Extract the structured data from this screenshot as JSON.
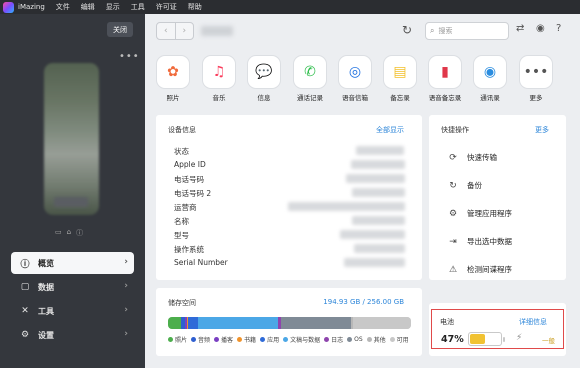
{
  "menubar": {
    "app_name": "iMazing",
    "items": [
      "文件",
      "编辑",
      "显示",
      "工具",
      "许可证",
      "帮助"
    ]
  },
  "sidebar": {
    "close_label": "关闭",
    "more": "•••",
    "nav": [
      {
        "label": "概览",
        "icon": "info-icon"
      },
      {
        "label": "数据",
        "icon": "square-icon"
      },
      {
        "label": "工具",
        "icon": "tools-icon"
      },
      {
        "label": "设置",
        "icon": "gear-icon"
      }
    ]
  },
  "toolbar": {
    "search_placeholder": "搜索"
  },
  "apps": [
    {
      "label": "照片",
      "icon": "photos-icon",
      "glyph": "✿",
      "color": "#f06a3b"
    },
    {
      "label": "音乐",
      "icon": "music-icon",
      "glyph": "♫",
      "color": "#fa3c5c"
    },
    {
      "label": "信息",
      "icon": "messages-icon",
      "glyph": "💬",
      "color": "#2cbd4a"
    },
    {
      "label": "通话记录",
      "icon": "phone-icon",
      "glyph": "✆",
      "color": "#2cbd4a"
    },
    {
      "label": "语音信箱",
      "icon": "voicemail-icon",
      "glyph": "◎",
      "color": "#1d6fe0"
    },
    {
      "label": "备忘录",
      "icon": "notes-icon",
      "glyph": "▤",
      "color": "#f2c12e"
    },
    {
      "label": "语音备忘录",
      "icon": "voice-memos-icon",
      "glyph": "▮",
      "color": "#e0374a"
    },
    {
      "label": "通讯录",
      "icon": "contacts-icon",
      "glyph": "◉",
      "color": "#2a8de0"
    },
    {
      "label": "更多",
      "icon": "more-icon",
      "glyph": "•••",
      "color": "#555"
    }
  ],
  "device_info": {
    "title": "设备信息",
    "show_all": "全部显示",
    "rows": [
      "状态",
      "Apple ID",
      "电话号码",
      "电话号码 2",
      "运营商",
      "名称",
      "型号",
      "操作系统",
      "Serial Number"
    ]
  },
  "quick_ops": {
    "title": "快捷操作",
    "more": "更多",
    "items": [
      {
        "label": "快速传输",
        "icon": "quick-transfer-icon",
        "glyph": "⟳"
      },
      {
        "label": "备份",
        "icon": "backup-icon",
        "glyph": "↻"
      },
      {
        "label": "管理应用程序",
        "icon": "apps-icon",
        "glyph": "⚙"
      },
      {
        "label": "导出选中数据",
        "icon": "export-icon",
        "glyph": "⇥"
      },
      {
        "label": "检测间谍程序",
        "icon": "spyware-icon",
        "glyph": "⚠"
      }
    ]
  },
  "storage": {
    "title": "储存空间",
    "usage": "194.93 GB / 256.00 GB",
    "used_fraction": 0.761,
    "segments": [
      {
        "name": "照片",
        "color": "#4cae4c",
        "pct": 5.5
      },
      {
        "name": "音频",
        "color": "#2f5fd0",
        "pct": 1.5
      },
      {
        "name": "播客",
        "color": "#7a3fc2",
        "pct": 0.8
      },
      {
        "name": "书籍",
        "color": "#f0932b",
        "pct": 0.5
      },
      {
        "name": "应用",
        "color": "#2f6bd8",
        "pct": 4.0
      },
      {
        "name": "文稿与数据",
        "color": "#4ba7e6",
        "pct": 33.0
      },
      {
        "name": "日志",
        "color": "#8e44ad",
        "pct": 1.2
      },
      {
        "name": "OS",
        "color": "#7f8a96",
        "pct": 29.0
      },
      {
        "name": "其他",
        "color": "#b7b7b7",
        "pct": 0.8
      },
      {
        "name": "可用",
        "color": "#c8c8c8",
        "pct": 23.7
      }
    ]
  },
  "battery": {
    "title": "电池",
    "details": "详细信息",
    "percent": "47%",
    "level": 0.47,
    "status": "一般"
  }
}
